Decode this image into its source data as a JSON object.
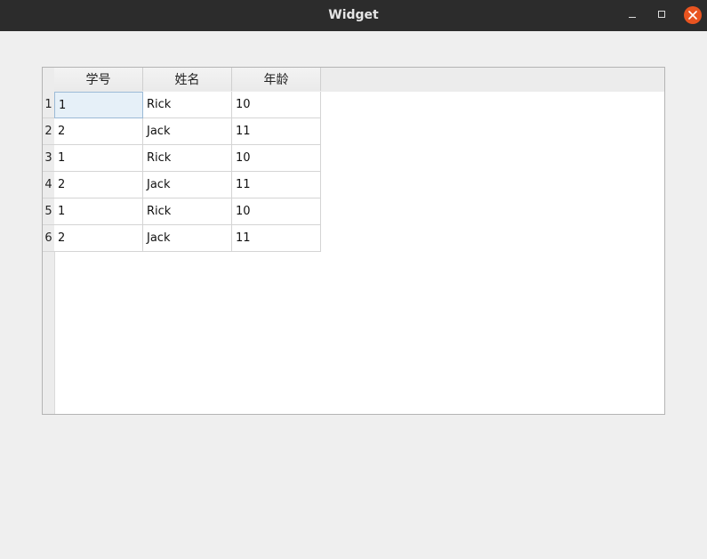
{
  "window": {
    "title": "Widget"
  },
  "table": {
    "columns": [
      "学号",
      "姓名",
      "年龄"
    ],
    "row_headers": [
      "1",
      "2",
      "3",
      "4",
      "5",
      "6"
    ],
    "rows": [
      [
        "1",
        "Rick",
        "10"
      ],
      [
        "2",
        "Jack",
        "11"
      ],
      [
        "1",
        "Rick",
        "10"
      ],
      [
        "2",
        "Jack",
        "11"
      ],
      [
        "1",
        "Rick",
        "10"
      ],
      [
        "2",
        "Jack",
        "11"
      ]
    ],
    "selected_cell": {
      "row": 0,
      "col": 0
    }
  }
}
